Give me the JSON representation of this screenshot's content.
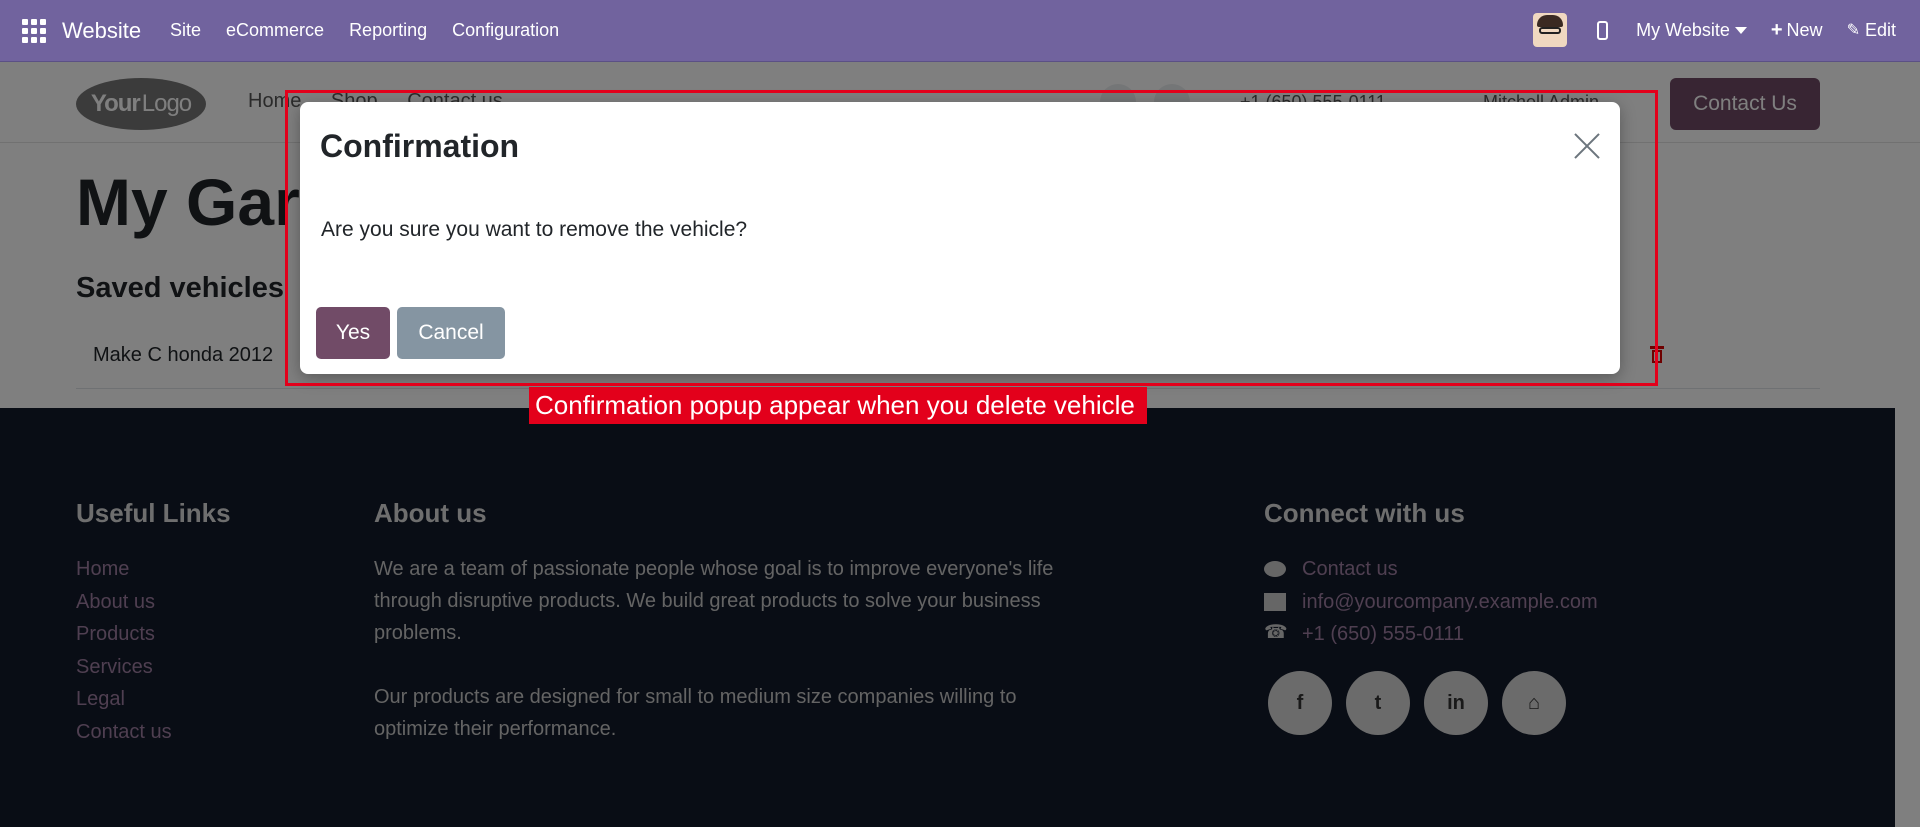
{
  "topbar": {
    "brand": "Website",
    "menu": [
      "Site",
      "eCommerce",
      "Reporting",
      "Configuration"
    ],
    "website_selector": "My Website",
    "new_label": "New",
    "edit_label": "Edit",
    "bg_color": "#71639e"
  },
  "site_header": {
    "logo_text_1": "Your",
    "logo_text_2": "Logo",
    "nav": [
      "Home",
      "Shop",
      "Contact us"
    ],
    "phone": "+1 (650) 555-0111",
    "user": "Mitchell Admin",
    "contact_button": "Contact Us"
  },
  "page": {
    "title": "My Garage",
    "saved_heading": "Saved vehicles",
    "vehicle": "Make C honda 2012"
  },
  "footer": {
    "useful_links_title": "Useful Links",
    "useful_links": [
      "Home",
      "About us",
      "Products",
      "Services",
      "Legal",
      "Contact us"
    ],
    "about_title": "About us",
    "about_p1": "We are a team of passionate people whose goal is to improve everyone's life through disruptive products. We build great products to solve your business problems.",
    "about_p2": "Our products are designed for small to medium size companies willing to optimize their performance.",
    "connect_title": "Connect with us",
    "connect_contact": "Contact us",
    "connect_email": "info@yourcompany.example.com",
    "connect_phone": "+1 (650) 555-0111",
    "social": [
      "f",
      "t",
      "in",
      "home"
    ]
  },
  "modal": {
    "title": "Confirmation",
    "body": "Are you sure you want to remove the vehicle?",
    "yes_label": "Yes",
    "cancel_label": "Cancel"
  },
  "annotation": {
    "label": "Confirmation popup appear when you delete vehicle",
    "color": "#e3001b"
  }
}
